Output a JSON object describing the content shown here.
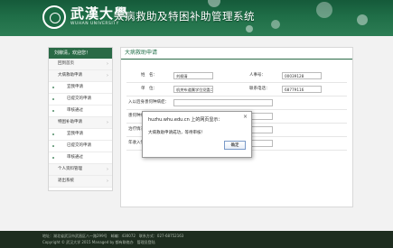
{
  "header": {
    "university_name": "武漢大學",
    "university_en": "WUHAN UNIVERSITY",
    "system_title": "大病救助及特困补助管理系统"
  },
  "sidebar": {
    "welcome": "刘柳清，欢迎您！",
    "items": [
      {
        "label": "回到首页",
        "level": "top"
      },
      {
        "label": "大病救助申请",
        "level": "top"
      },
      {
        "label": "宜我申请",
        "level": "sub"
      },
      {
        "label": "已提交的申请",
        "level": "sub"
      },
      {
        "label": "审核通过",
        "level": "sub"
      },
      {
        "label": "特困补助申请",
        "level": "top"
      },
      {
        "label": "宜我申请",
        "level": "sub"
      },
      {
        "label": "已提交的申请",
        "level": "sub"
      },
      {
        "label": "审核通过",
        "level": "sub"
      },
      {
        "label": "个人资料管理",
        "level": "top"
      },
      {
        "label": "退出系统",
        "level": "top"
      }
    ]
  },
  "content": {
    "title": "大病救助申请",
    "form": {
      "name_label": "姓　名：",
      "name_value": "刘柳清",
      "id_label": "人事号：",
      "id_value": "00039128",
      "unit_label": "单　位：",
      "unit_value": "机关布道属学位党委二支",
      "phone_label": "联系电话：",
      "phone_value": "68779116",
      "row3_label": "入以后身患何种病症：",
      "row4_label": "患何种病症：",
      "row5_label": "治疗情况：",
      "row6_label": "年收入情况："
    }
  },
  "dialog": {
    "title": "huzhu.whu.edu.cn 上的网页显示：",
    "message": "大病救助申请成功，等待审核！",
    "ok_label": "确定",
    "close_glyph": "×"
  },
  "footer": {
    "line1": "地址：湖北省武汉市武昌区八一路299号　邮编：430072　联系方式：027-68752163",
    "line2": "Copyright © 武汉大学 2015 Managed by 都有联络办　管理员登陆"
  }
}
